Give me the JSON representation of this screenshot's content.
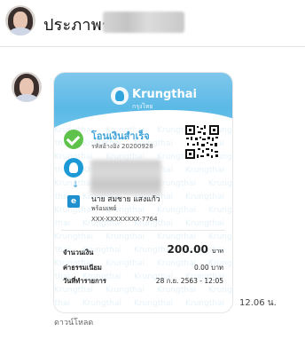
{
  "header": {
    "contact_name": "ประภาพร"
  },
  "message": {
    "timestamp": "12.06 น.",
    "download_label": "ดาวน์โหลด"
  },
  "receipt": {
    "bank_name": "Krungthai",
    "bank_name_thai": "กรุงไทย",
    "status_title": "โอนเงินสำเร็จ",
    "reference_code": "รหัสอ้างอิง 20200928",
    "recipient_name": "นาย สมชาย แสงแก้ว",
    "recipient_service": "พร้อมเพย์",
    "recipient_account": "XXX-XXXXXXXX-7764",
    "amount_label": "จำนวนเงิน",
    "amount_value": "200.00",
    "amount_unit": "บาท",
    "fee_label": "ค่าธรรมเนียม",
    "fee_value": "0.00 บาท",
    "date_label": "วันที่ทำรายการ",
    "date_value": "28 ก.ย. 2563 - 12:05",
    "watermark_text": "Krungthai"
  },
  "icons": {
    "success": "check-circle-icon",
    "bank": "krungthai-logo-icon",
    "arrow": "arrow-down-icon",
    "ewallet": "ewallet-icon"
  },
  "colors": {
    "banner": "#5bb9e6",
    "success": "#5fc24a",
    "accent_blue": "#3ea2d8"
  }
}
